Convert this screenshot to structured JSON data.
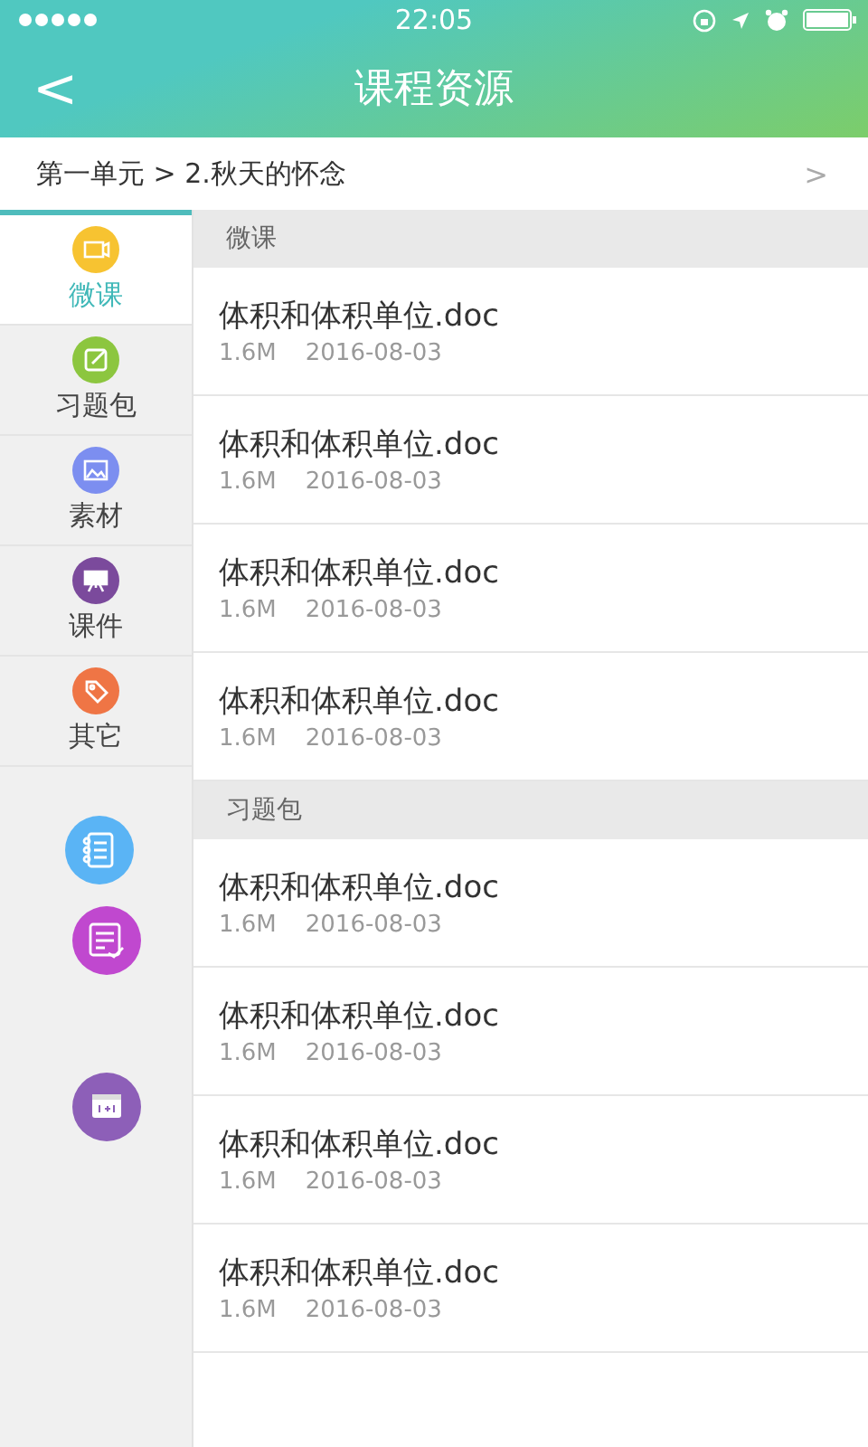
{
  "status_bar": {
    "time": "22:05"
  },
  "header": {
    "back": "<",
    "title": "课程资源"
  },
  "breadcrumb": {
    "text": "第一单元 > 2.秋天的怀念",
    "chevron": ">"
  },
  "sidebar": {
    "items": [
      {
        "label": "微课",
        "kind": "video",
        "color": "#f7c331",
        "selected": true
      },
      {
        "label": "习题包",
        "kind": "edit",
        "color": "#8cc63f",
        "selected": false
      },
      {
        "label": "素材",
        "kind": "image",
        "color": "#7c8ef0",
        "selected": false
      },
      {
        "label": "课件",
        "kind": "board",
        "color": "#7b4a9c",
        "selected": false
      },
      {
        "label": "其它",
        "kind": "tag",
        "color": "#ef7545",
        "selected": false
      }
    ]
  },
  "sections": [
    {
      "title": "微课",
      "files": [
        {
          "name": "体积和体积单位.doc",
          "size": "1.6M",
          "date": "2016-08-03"
        },
        {
          "name": "体积和体积单位.doc",
          "size": "1.6M",
          "date": "2016-08-03"
        },
        {
          "name": "体积和体积单位.doc",
          "size": "1.6M",
          "date": "2016-08-03"
        },
        {
          "name": "体积和体积单位.doc",
          "size": "1.6M",
          "date": "2016-08-03"
        }
      ]
    },
    {
      "title": "习题包",
      "files": [
        {
          "name": "体积和体积单位.doc",
          "size": "1.6M",
          "date": "2016-08-03"
        },
        {
          "name": "体积和体积单位.doc",
          "size": "1.6M",
          "date": "2016-08-03"
        },
        {
          "name": "体积和体积单位.doc",
          "size": "1.6M",
          "date": "2016-08-03"
        },
        {
          "name": "体积和体积单位.doc",
          "size": "1.6M",
          "date": "2016-08-03"
        }
      ]
    }
  ]
}
